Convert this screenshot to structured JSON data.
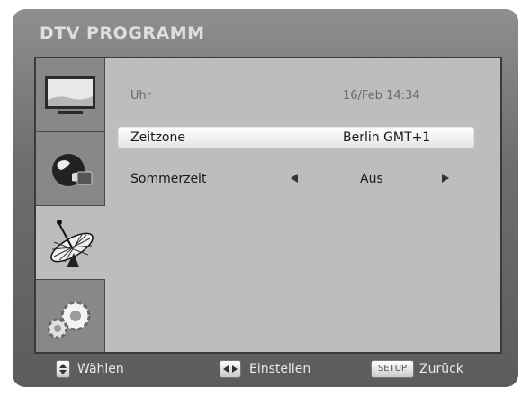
{
  "window": {
    "title": "DTV PROGRAMM"
  },
  "sidebar": {
    "tabs": [
      {
        "name": "tv-icon",
        "active": false
      },
      {
        "name": "globe-icon",
        "active": false
      },
      {
        "name": "satellite-dish-icon",
        "active": true
      },
      {
        "name": "gears-icon",
        "active": false
      }
    ]
  },
  "settings": {
    "clock": {
      "label": "Uhr",
      "value": "16/Feb  14:34"
    },
    "timezone": {
      "label": "Zeitzone",
      "value": "Berlin GMT+1"
    },
    "dst": {
      "label": "Sommerzeit",
      "value": "Aus"
    }
  },
  "footer": {
    "select": {
      "label": "Wählen",
      "icon": "updown-key-icon"
    },
    "adjust": {
      "label": "Einstellen",
      "icon": "leftright-key-icon"
    },
    "back": {
      "key": "SETUP",
      "label": "Zurück"
    }
  }
}
